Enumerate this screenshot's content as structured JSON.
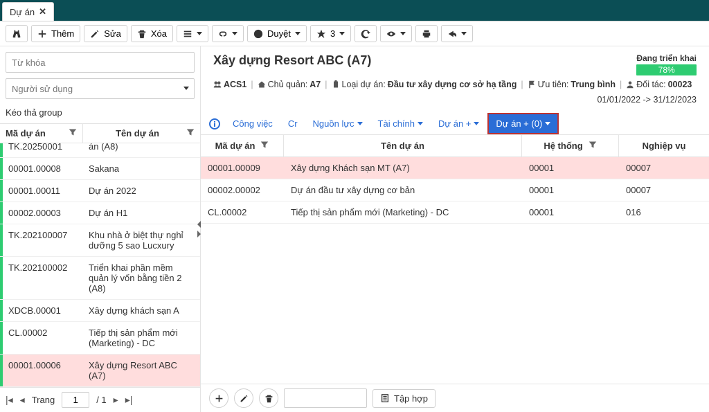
{
  "header": {
    "tab_label": "Dự án"
  },
  "toolbar": {
    "add_label": "Thêm",
    "edit_label": "Sửa",
    "delete_label": "Xóa",
    "browse_label": "Duyệt",
    "star_label": "3"
  },
  "left": {
    "search_placeholder": "Từ khóa",
    "user_placeholder": "Người sử dụng",
    "drop_hint": "Kéo thả group",
    "col_code": "Mã dự án",
    "col_name": "Tên dự án",
    "rows": [
      {
        "status": "green",
        "code": "TK.20250001",
        "name": "án (A8)"
      },
      {
        "status": "green",
        "code": "00001.00008",
        "name": "Sakana"
      },
      {
        "status": "green",
        "code": "00001.00011",
        "name": "Dự án 2022"
      },
      {
        "status": "green",
        "code": "00002.00003",
        "name": "Dự án H1"
      },
      {
        "status": "green",
        "code": "TK.202100007",
        "name": "Khu nhà ở biệt thự nghỉ dưỡng 5 sao Lucxury"
      },
      {
        "status": "green",
        "code": "TK.202100002",
        "name": "Triển khai phần mềm quản lý vốn bằng tiền 2 (A8)"
      },
      {
        "status": "green",
        "code": "XDCB.00001",
        "name": "Xây dựng khách sạn A"
      },
      {
        "status": "green",
        "code": "CL.00002",
        "name": "Tiếp thị sản phẩm mới (Marketing) - DC"
      },
      {
        "status": "green",
        "code": "00001.00006",
        "name": "Xây dựng Resort ABC (A7)",
        "selected": true
      }
    ],
    "pager": {
      "label": "Trang",
      "current": "1",
      "total": "/ 1"
    }
  },
  "detail": {
    "title": "Xây dựng Resort ABC (A7)",
    "status": "Đang triển khai",
    "progress": "78%",
    "code": "ACS1",
    "owner_label": "Chủ quản:",
    "owner": "A7",
    "type_label": "Loại dự án:",
    "type": "Đầu tư xây dựng cơ sở hạ tầng",
    "priority_label": "Ưu tiên:",
    "priority": "Trung bình",
    "partner_label": "Đối tác:",
    "partner": "00023",
    "date_range": "01/01/2022 -> 31/12/2023",
    "tabs": {
      "congviec": "Công việc",
      "cr": "Cr",
      "nguonluc": "Nguồn lực",
      "taichinh": "Tài chính",
      "duan_plus": "Dự án +",
      "duan_count": "Dự án + (0)"
    },
    "grid": {
      "col_code": "Mã dự án",
      "col_name": "Tên dự án",
      "col_system": "Hệ thống",
      "col_biz": "Nghiệp vụ",
      "rows": [
        {
          "code": "00001.00009",
          "name": "Xây dựng Khách sạn MT (A7)",
          "system": "00001",
          "biz": "00007",
          "selected": true
        },
        {
          "code": "00002.00002",
          "name": "Dự án đầu tư xây dựng cơ bản",
          "system": "00001",
          "biz": "00007"
        },
        {
          "code": "CL.00002",
          "name": "Tiếp thị sản phẩm mới (Marketing) - DC",
          "system": "00001",
          "biz": "016"
        }
      ]
    },
    "footer": {
      "taphop": "Tập hợp"
    }
  }
}
